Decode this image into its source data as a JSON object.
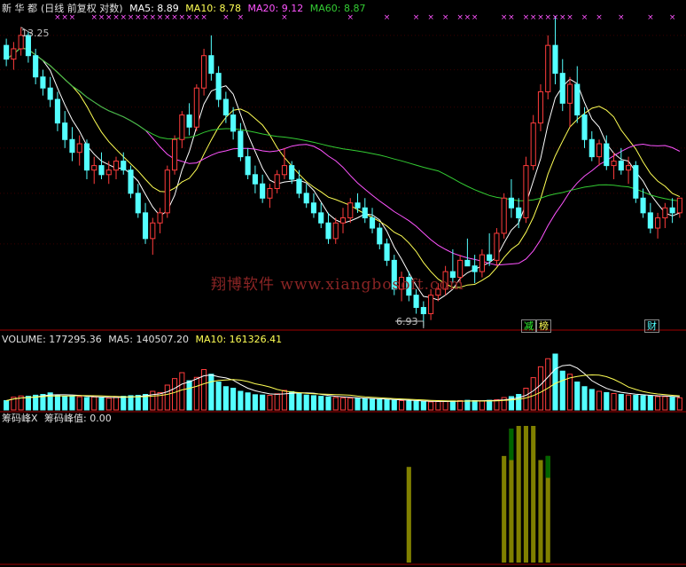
{
  "price_panel": {
    "header": {
      "stock_name": "新 华 都",
      "mode": "(日线 前复权 对数)",
      "ma5": "MA5: 8.89",
      "ma10": "MA10: 8.78",
      "ma20": "MA20: 9.12",
      "ma60": "MA60: 8.87"
    },
    "high_label": "13.25",
    "low_label": "6.93",
    "watermark": "翔博软件 www.xiangbosoft.com",
    "tags": [
      "减",
      "榜",
      "财"
    ]
  },
  "volume_panel": {
    "header": {
      "volume": "VOLUME: 177295.36",
      "ma5": "MA5: 140507.20",
      "ma10": "MA10: 161326.41"
    }
  },
  "chip_panel": {
    "header": {
      "name": "筹码峰X",
      "value": "筹码峰值: 0.00"
    }
  },
  "colors": {
    "up": "#ff3c3c",
    "down": "#54ffff",
    "ma5": "#ffffff",
    "ma10": "#ffff54",
    "ma20": "#ff54ff",
    "ma60": "#33cc33",
    "chip_bar": "#808000",
    "chip_peak": "#006400",
    "marker": "#ff54ff"
  },
  "chart_data": [
    {
      "type": "candlestick",
      "scale": "log",
      "ylim": [
        6.6,
        13.6
      ],
      "candles": [
        [
          12.7,
          12.9,
          12.1,
          12.3
        ],
        [
          12.3,
          12.8,
          12.0,
          12.6
        ],
        [
          12.6,
          13.25,
          12.4,
          13.0
        ],
        [
          13.0,
          13.1,
          12.2,
          12.4
        ],
        [
          12.4,
          12.6,
          11.6,
          11.8
        ],
        [
          11.8,
          12.0,
          11.3,
          11.5
        ],
        [
          11.5,
          11.8,
          11.0,
          11.2
        ],
        [
          11.2,
          11.4,
          10.4,
          10.6
        ],
        [
          10.6,
          10.9,
          10.0,
          10.2
        ],
        [
          10.2,
          10.5,
          9.7,
          9.9
        ],
        [
          9.9,
          10.3,
          9.6,
          10.1
        ],
        [
          10.1,
          10.2,
          9.3,
          9.5
        ],
        [
          9.5,
          9.8,
          9.2,
          9.6
        ],
        [
          9.6,
          9.9,
          9.3,
          9.4
        ],
        [
          9.4,
          9.7,
          9.2,
          9.5
        ],
        [
          9.5,
          9.8,
          9.3,
          9.7
        ],
        [
          9.7,
          9.9,
          9.4,
          9.5
        ],
        [
          9.5,
          9.6,
          8.9,
          9.0
        ],
        [
          9.0,
          9.2,
          8.5,
          8.6
        ],
        [
          8.6,
          8.8,
          8.0,
          8.1
        ],
        [
          8.1,
          8.5,
          7.8,
          8.4
        ],
        [
          8.4,
          8.7,
          8.2,
          8.6
        ],
        [
          8.6,
          9.6,
          8.5,
          9.5
        ],
        [
          9.5,
          10.3,
          9.4,
          10.2
        ],
        [
          10.2,
          10.9,
          10.0,
          10.8
        ],
        [
          10.8,
          11.1,
          10.3,
          10.5
        ],
        [
          10.5,
          11.6,
          10.4,
          11.5
        ],
        [
          11.5,
          12.6,
          11.3,
          12.4
        ],
        [
          12.4,
          13.0,
          11.7,
          11.9
        ],
        [
          11.9,
          12.1,
          11.0,
          11.2
        ],
        [
          11.2,
          11.4,
          10.6,
          10.8
        ],
        [
          10.8,
          11.0,
          10.2,
          10.4
        ],
        [
          10.4,
          10.6,
          9.7,
          9.8
        ],
        [
          9.8,
          10.0,
          9.3,
          9.4
        ],
        [
          9.4,
          9.6,
          9.0,
          9.2
        ],
        [
          9.2,
          9.4,
          8.8,
          8.9
        ],
        [
          8.9,
          9.2,
          8.7,
          9.1
        ],
        [
          9.1,
          9.5,
          9.0,
          9.4
        ],
        [
          9.4,
          10.0,
          9.3,
          9.6
        ],
        [
          9.6,
          9.7,
          9.2,
          9.3
        ],
        [
          9.3,
          9.5,
          8.9,
          9.0
        ],
        [
          9.0,
          9.2,
          8.7,
          8.8
        ],
        [
          8.8,
          9.0,
          8.5,
          8.6
        ],
        [
          8.6,
          8.8,
          8.3,
          8.4
        ],
        [
          8.4,
          8.6,
          8.0,
          8.1
        ],
        [
          8.1,
          8.5,
          8.0,
          8.4
        ],
        [
          8.4,
          8.7,
          8.2,
          8.5
        ],
        [
          8.5,
          8.9,
          8.4,
          8.8
        ],
        [
          8.8,
          9.0,
          8.6,
          8.7
        ],
        [
          8.7,
          8.9,
          8.4,
          8.5
        ],
        [
          8.5,
          8.7,
          8.2,
          8.3
        ],
        [
          8.3,
          8.4,
          7.9,
          8.0
        ],
        [
          8.0,
          8.1,
          7.6,
          7.7
        ],
        [
          7.7,
          7.8,
          7.1,
          7.2
        ],
        [
          7.2,
          7.5,
          7.0,
          7.4
        ],
        [
          7.4,
          7.5,
          7.0,
          7.1
        ],
        [
          7.1,
          7.2,
          6.8,
          6.9
        ],
        [
          6.9,
          7.0,
          6.6,
          6.8
        ],
        [
          6.8,
          7.2,
          6.7,
          7.1
        ],
        [
          7.1,
          7.3,
          7.0,
          7.2
        ],
        [
          7.2,
          7.6,
          7.1,
          7.5
        ],
        [
          7.5,
          7.9,
          7.3,
          7.4
        ],
        [
          7.4,
          7.8,
          7.3,
          7.7
        ],
        [
          7.7,
          8.1,
          7.6,
          7.6
        ],
        [
          7.6,
          7.8,
          7.3,
          7.5
        ],
        [
          7.5,
          7.9,
          7.4,
          7.8
        ],
        [
          7.8,
          8.2,
          7.6,
          7.7
        ],
        [
          7.7,
          8.3,
          7.6,
          8.2
        ],
        [
          8.2,
          9.0,
          8.1,
          8.9
        ],
        [
          8.9,
          9.3,
          8.5,
          8.7
        ],
        [
          8.7,
          8.9,
          8.3,
          8.5
        ],
        [
          8.5,
          9.8,
          8.4,
          9.6
        ],
        [
          9.6,
          10.8,
          9.5,
          10.6
        ],
        [
          10.6,
          11.6,
          10.4,
          11.4
        ],
        [
          11.4,
          13.0,
          11.2,
          12.7
        ],
        [
          12.7,
          13.6,
          11.6,
          11.9
        ],
        [
          11.9,
          12.3,
          10.9,
          11.1
        ],
        [
          11.1,
          11.8,
          10.5,
          11.6
        ],
        [
          11.6,
          12.1,
          10.6,
          10.8
        ],
        [
          10.8,
          11.0,
          10.0,
          10.2
        ],
        [
          10.2,
          10.4,
          9.7,
          9.8
        ],
        [
          9.8,
          10.2,
          9.6,
          10.1
        ],
        [
          10.1,
          10.3,
          9.5,
          9.6
        ],
        [
          9.6,
          9.9,
          9.3,
          9.7
        ],
        [
          9.7,
          10.0,
          9.4,
          9.5
        ],
        [
          9.5,
          9.8,
          9.2,
          9.6
        ],
        [
          9.6,
          9.7,
          8.8,
          8.9
        ],
        [
          8.9,
          9.1,
          8.5,
          8.6
        ],
        [
          8.6,
          8.8,
          8.2,
          8.3
        ],
        [
          8.3,
          8.6,
          8.1,
          8.5
        ],
        [
          8.5,
          8.8,
          8.3,
          8.7
        ],
        [
          8.7,
          8.9,
          8.4,
          8.6
        ],
        [
          8.6,
          8.9,
          8.5,
          8.9
        ]
      ],
      "ma_labels": [
        "MA5",
        "MA10",
        "MA20",
        "MA60"
      ],
      "high_marker": 13.25,
      "low_marker": 6.93
    },
    {
      "type": "bar",
      "title": "VOLUME",
      "values": [
        60,
        82,
        90,
        88,
        95,
        100,
        110,
        96,
        88,
        90,
        85,
        80,
        84,
        78,
        76,
        82,
        88,
        92,
        94,
        100,
        120,
        112,
        160,
        202,
        240,
        188,
        210,
        260,
        230,
        180,
        150,
        140,
        120,
        110,
        98,
        96,
        94,
        104,
        126,
        118,
        108,
        96,
        92,
        88,
        84,
        80,
        78,
        76,
        74,
        72,
        70,
        68,
        66,
        62,
        60,
        58,
        56,
        54,
        52,
        54,
        56,
        58,
        60,
        62,
        60,
        58,
        62,
        66,
        80,
        86,
        100,
        140,
        208,
        278,
        330,
        360,
        250,
        230,
        180,
        150,
        132,
        120,
        112,
        106,
        100,
        96,
        94,
        92,
        90,
        86,
        86,
        82,
        78
      ],
      "ylim": [
        0,
        400
      ]
    },
    {
      "type": "bar",
      "title": "筹码峰X",
      "values": [
        0,
        0,
        0,
        0,
        0,
        0,
        0,
        0,
        0,
        0,
        0,
        0,
        0,
        0,
        0,
        0,
        0,
        0,
        0,
        0,
        0,
        0,
        0,
        0,
        0,
        0,
        0,
        0,
        0,
        0,
        0,
        0,
        0,
        0,
        0,
        0,
        0,
        0,
        0,
        0,
        0,
        0,
        0,
        0,
        0,
        0,
        0,
        0,
        0,
        0,
        0,
        0,
        0,
        0,
        0,
        0,
        0,
        0,
        0,
        0,
        0,
        0,
        0,
        0,
        0,
        0,
        0,
        0,
        0,
        0,
        0,
        0,
        0,
        0,
        0,
        0,
        0,
        0,
        0,
        0,
        0,
        0,
        0,
        0,
        0,
        0,
        0,
        0,
        0,
        0,
        0,
        0,
        0
      ],
      "peaks": [
        {
          "i": 55,
          "v": 0.7
        },
        {
          "i": 68,
          "v": 0.78
        },
        {
          "i": 69,
          "v": 0.98
        },
        {
          "i": 70,
          "v": 1.0
        },
        {
          "i": 71,
          "v": 1.0
        },
        {
          "i": 72,
          "v": 1.0
        },
        {
          "i": 73,
          "v": 0.75
        },
        {
          "i": 74,
          "v": 0.78
        }
      ],
      "ylim": [
        0,
        1
      ]
    }
  ]
}
